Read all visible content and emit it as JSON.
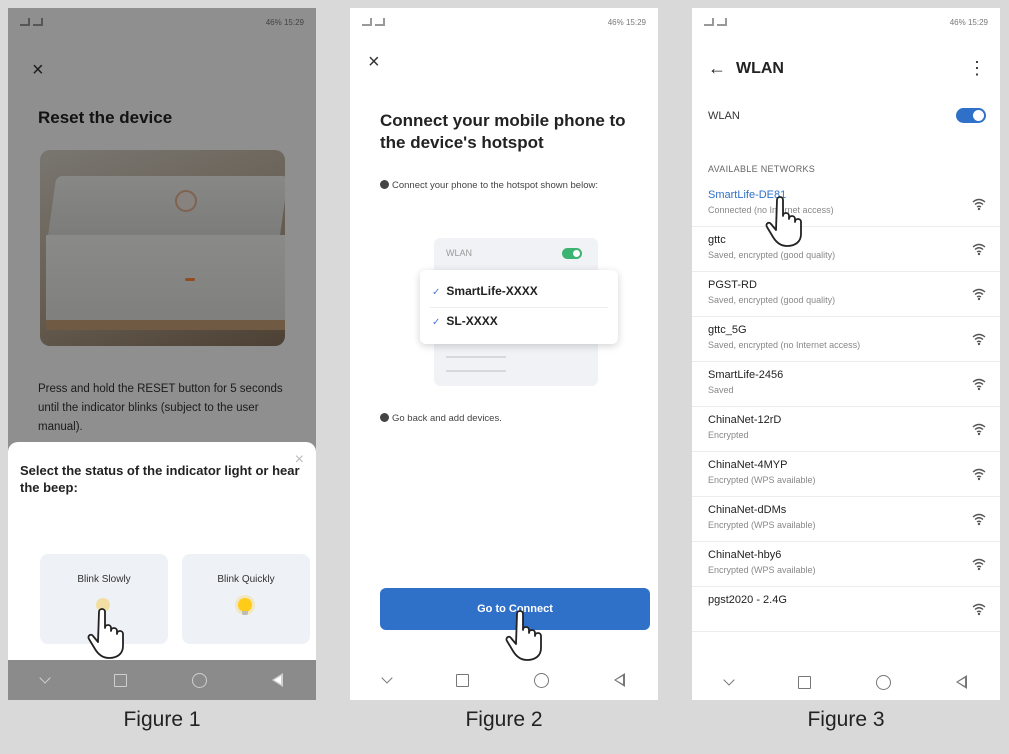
{
  "status_bar": {
    "battery_time": "46% 15:29"
  },
  "figure1": {
    "caption": "Figure 1",
    "close_icon": "×",
    "title": "Reset the device",
    "description": "Press and hold the RESET button for 5 seconds until the indicator blinks (subject to the user manual).",
    "sheet": {
      "title": "Select the status of the indicator light or hear the beep:",
      "close_icon": "×",
      "options": [
        {
          "label": "Blink Slowly"
        },
        {
          "label": "Blink Quickly"
        }
      ]
    }
  },
  "figure2": {
    "caption": "Figure 2",
    "close_icon": "×",
    "title": "Connect your mobile phone to the device's hotspot",
    "step1": "Connect your phone to the hotspot shown below:",
    "hotspot_card": {
      "wlan_label": "WLAN",
      "networks": [
        "SmartLife-XXXX",
        "SL-XXXX"
      ],
      "check_icon": "✓"
    },
    "step2": "Go back and add devices.",
    "connect_button": "Go to Connect"
  },
  "figure3": {
    "caption": "Figure 3",
    "back_icon": "←",
    "title": "WLAN",
    "more_icon": "⋮",
    "wlan_toggle_label": "WLAN",
    "available_label": "AVAILABLE NETWORKS",
    "networks": [
      {
        "name": "SmartLife-DE81",
        "status": "Connected (no Internet access)",
        "active": true
      },
      {
        "name": "gttc",
        "status": "Saved, encrypted (good quality)"
      },
      {
        "name": "PGST-RD",
        "status": "Saved, encrypted (good quality)"
      },
      {
        "name": "gttc_5G",
        "status": "Saved, encrypted (no Internet access)"
      },
      {
        "name": "SmartLife-2456",
        "status": "Saved"
      },
      {
        "name": "ChinaNet-12rD",
        "status": "Encrypted"
      },
      {
        "name": "ChinaNet-4MYP",
        "status": "Encrypted (WPS available)"
      },
      {
        "name": "ChinaNet-dDMs",
        "status": "Encrypted (WPS available)"
      },
      {
        "name": "ChinaNet-hby6",
        "status": "Encrypted (WPS available)"
      },
      {
        "name": "pgst2020 - 2.4G",
        "status": ""
      }
    ]
  },
  "icons": {
    "hand_cursor": "pointing-hand-icon",
    "wifi": "wifi-signal-icon",
    "bulb": "light-bulb-icon"
  },
  "colors": {
    "accent_blue": "#2f70c9",
    "toggle_green": "#3cb371",
    "bulb_yellow": "#ffcc1a"
  }
}
